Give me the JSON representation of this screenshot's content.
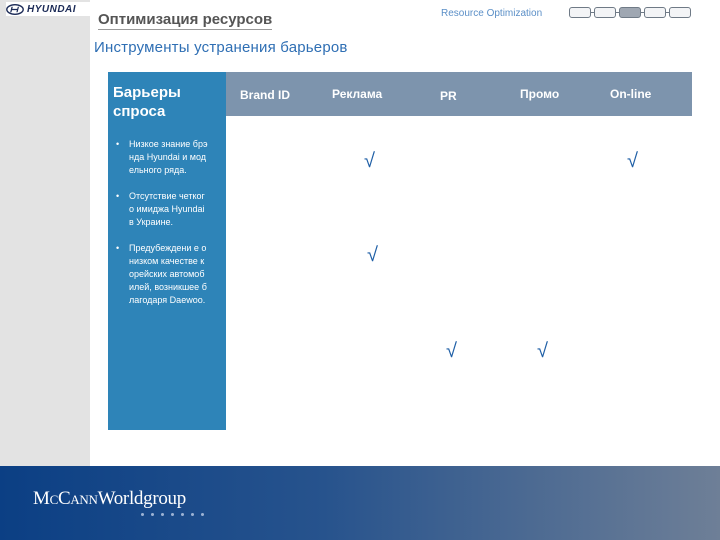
{
  "brand": {
    "logo_text": "HYUNDAI"
  },
  "slide": {
    "title": "Оптимизация ресурсов",
    "subtitle": "Инструменты устранения барьеров",
    "section_label": "Resource Optimization",
    "steps_total": 5,
    "active_step": 3
  },
  "table": {
    "row_header": "Барьеры спроса",
    "columns": [
      "Brand ID",
      "Реклама",
      "PR",
      "Промо",
      "On-line"
    ],
    "barriers": [
      "Низкое знание брэнда Hyundai и модельного ряда.",
      "Отсутствие четкого имиджа Hyundai в Украине.",
      "Предубеждени е о низком качестве корейских автомобилей, возникшее благодаря Daewoo."
    ],
    "check_symbol": "√",
    "checks": [
      {
        "barrier": 0,
        "column": "Реклама"
      },
      {
        "barrier": 0,
        "column": "On-line"
      },
      {
        "barrier": 1,
        "column": "Реклама"
      },
      {
        "barrier": 2,
        "column": "PR"
      },
      {
        "barrier": 2,
        "column": "Промо"
      }
    ]
  },
  "footer": {
    "company": "McCannWorldgroup",
    "company_prefix": "McCann",
    "company_suffix": "Worldgroup"
  },
  "colors": {
    "accent_blue": "#2e84b8",
    "header_gray_blue": "#7d94ad",
    "check_blue": "#1f5fa6"
  }
}
